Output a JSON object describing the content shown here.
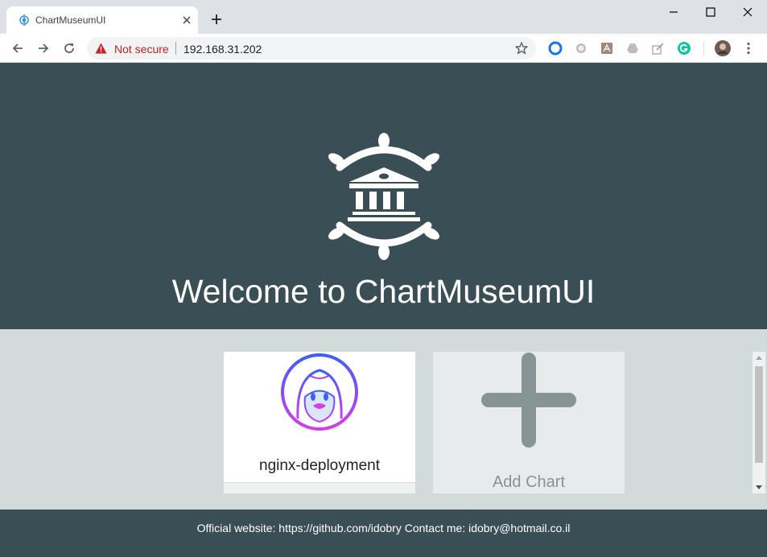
{
  "browser": {
    "tab": {
      "title": "ChartMuseumUI"
    },
    "omnibox": {
      "security_label": "Not secure",
      "url": "192.168.31.202"
    },
    "extensions": [
      "circle-blue-icon",
      "circle-grey-icon",
      "pdf-icon",
      "drive-icon",
      "edit-icon",
      "grammarly-icon"
    ],
    "colors": {
      "tabstrip": "#dee1e6",
      "warning": "#c5221f"
    }
  },
  "page": {
    "welcome_title": "Welcome to ChartMuseumUI",
    "charts": [
      {
        "name": "nginx-deployment",
        "icon": "penguin-avatar-icon"
      }
    ],
    "add_chart_label": "Add Chart",
    "footer_text": "Official website: https://github.com/idobry Contact me: idobry@hotmail.co.il",
    "colors": {
      "hero": "#3a4e55",
      "content": "#d3dbda",
      "plus": "#869493"
    }
  }
}
